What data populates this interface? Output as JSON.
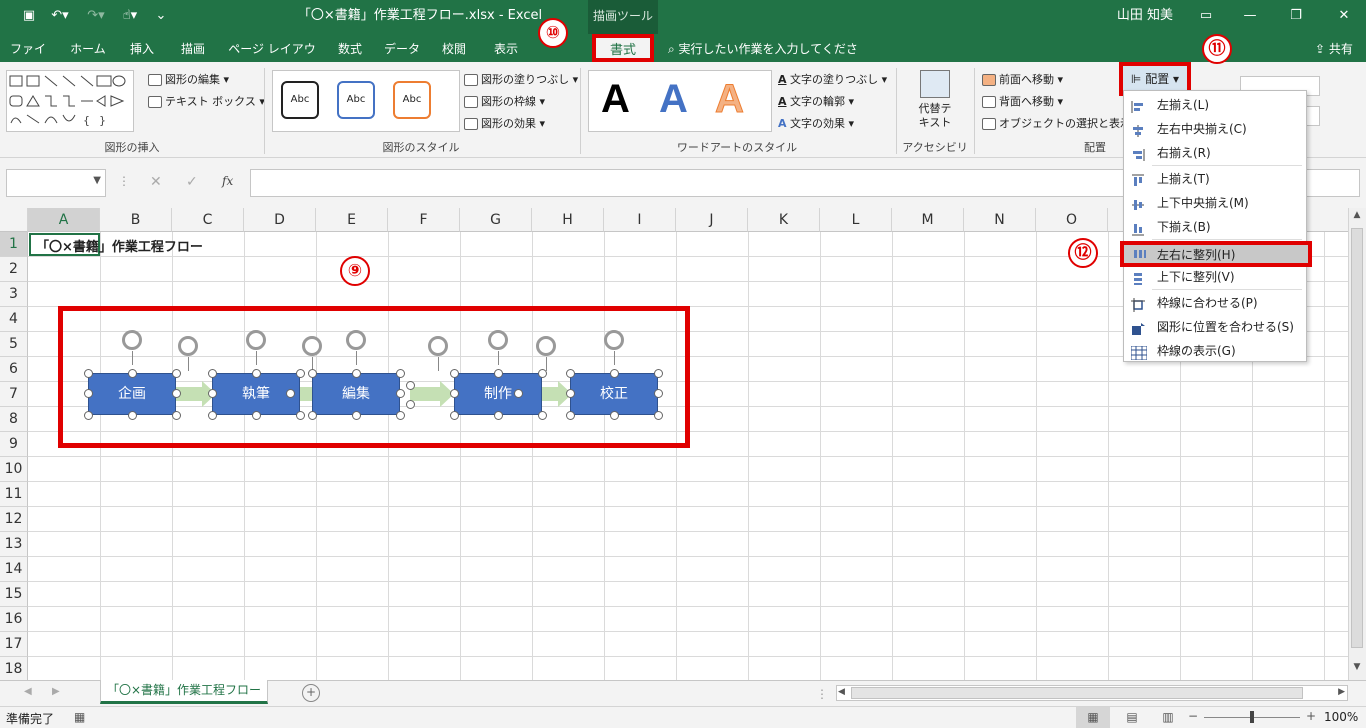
{
  "titlebar": {
    "title": "「〇×書籍」作業工程フロー.xlsx  -  Excel",
    "context": "描画ツール",
    "user": "山田 知美"
  },
  "tabs": [
    "ファイル",
    "ホーム",
    "挿入",
    "描画",
    "ページ レイアウト",
    "数式",
    "データ",
    "校閲",
    "表示",
    "書式"
  ],
  "tellme": "実行したい作業を入力してください",
  "share": "共有",
  "ribbon": {
    "insert_shapes": {
      "edit_shape": "図形の編集",
      "textbox": "テキスト ボックス",
      "label": "図形の挿入"
    },
    "shape_styles": {
      "abc": "Abc",
      "fill": "図形の塗りつぶし",
      "outline": "図形の枠線",
      "effects": "図形の効果",
      "label": "図形のスタイル"
    },
    "wordart": {
      "letter": "A",
      "fill": "文字の塗りつぶし",
      "outline": "文字の輪郭",
      "effects": "文字の効果",
      "label": "ワードアートのスタイル"
    },
    "accessibility": {
      "alt_text_1": "代替テ",
      "alt_text_2": "キスト",
      "label": "アクセシビリティ"
    },
    "arrange": {
      "bring_forward": "前面へ移動",
      "send_backward": "背面へ移動",
      "selection_pane": "オブジェクトの選択と表示",
      "align": "配置",
      "label": "配置"
    }
  },
  "formula": {
    "fx": "fx"
  },
  "columns": [
    "A",
    "B",
    "C",
    "D",
    "E",
    "F",
    "G",
    "H",
    "I",
    "J",
    "K",
    "L",
    "M",
    "N",
    "O"
  ],
  "rows": [
    "1",
    "2",
    "3",
    "4",
    "5",
    "6",
    "7",
    "8",
    "9",
    "10",
    "11",
    "12",
    "13",
    "14",
    "15",
    "16",
    "17",
    "18"
  ],
  "cell_a1": "「〇×書籍」作業工程フロー",
  "shapes": [
    "企画",
    "執筆",
    "編集",
    "制作",
    "校正"
  ],
  "callouts": {
    "n9": "⑨",
    "n10": "⑩",
    "n11": "⑪",
    "n12": "⑫"
  },
  "align_menu": [
    {
      "label": "左揃え(L)",
      "icon": "align-left-icon"
    },
    {
      "label": "左右中央揃え(C)",
      "icon": "align-center-icon"
    },
    {
      "label": "右揃え(R)",
      "icon": "align-right-icon"
    },
    {
      "label": "上揃え(T)",
      "icon": "align-top-icon"
    },
    {
      "label": "上下中央揃え(M)",
      "icon": "align-middle-icon"
    },
    {
      "label": "下揃え(B)",
      "icon": "align-bottom-icon"
    },
    {
      "label": "左右に整列(H)",
      "icon": "distribute-horizontal-icon"
    },
    {
      "label": "上下に整列(V)",
      "icon": "distribute-vertical-icon"
    },
    {
      "label": "枠線に合わせる(P)",
      "icon": "snap-grid-icon"
    },
    {
      "label": "図形に位置を合わせる(S)",
      "icon": "snap-shape-icon"
    },
    {
      "label": "枠線の表示(G)",
      "icon": "view-gridlines-icon"
    }
  ],
  "sheet_tab": "「〇×書籍」作業工程フロー",
  "status": {
    "ready": "準備完了",
    "zoom": "100%"
  },
  "colors": {
    "excel_green": "#217346",
    "shape_blue": "#4472c4",
    "arrow_green": "#c5e0b4",
    "highlight": "#e00000"
  }
}
